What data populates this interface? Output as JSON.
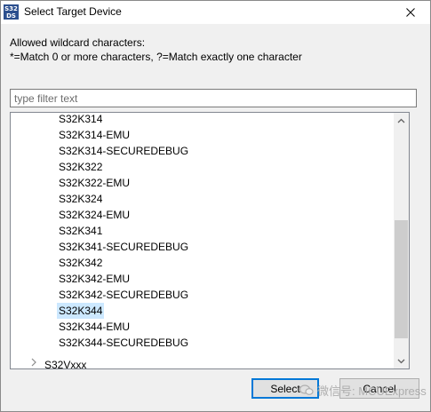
{
  "window": {
    "title": "Select Target Device",
    "app_icon_text_top": "S32",
    "app_icon_text_bottom": "DS"
  },
  "info": {
    "line1": "Allowed wildcard characters:",
    "line2": "*=Match 0 or more characters, ?=Match exactly one character"
  },
  "filter": {
    "placeholder": "type filter text",
    "value": ""
  },
  "tree": {
    "items": [
      {
        "label": "S32K314"
      },
      {
        "label": "S32K314-EMU"
      },
      {
        "label": "S32K314-SECUREDEBUG"
      },
      {
        "label": "S32K322"
      },
      {
        "label": "S32K322-EMU"
      },
      {
        "label": "S32K324"
      },
      {
        "label": "S32K324-EMU"
      },
      {
        "label": "S32K341"
      },
      {
        "label": "S32K341-SECUREDEBUG"
      },
      {
        "label": "S32K342"
      },
      {
        "label": "S32K342-EMU"
      },
      {
        "label": "S32K342-SECUREDEBUG"
      },
      {
        "label": "S32K344",
        "selected": true
      },
      {
        "label": "S32K344-EMU"
      },
      {
        "label": "S32K344-SECUREDEBUG"
      }
    ],
    "group": {
      "label": "S32Vxxx",
      "expanded": false
    }
  },
  "buttons": {
    "select": "Select",
    "cancel": "Cancel"
  },
  "watermark": "微信号: MCUExpress",
  "colors": {
    "selection": "#cce8ff",
    "default_button_border": "#0078d7"
  }
}
